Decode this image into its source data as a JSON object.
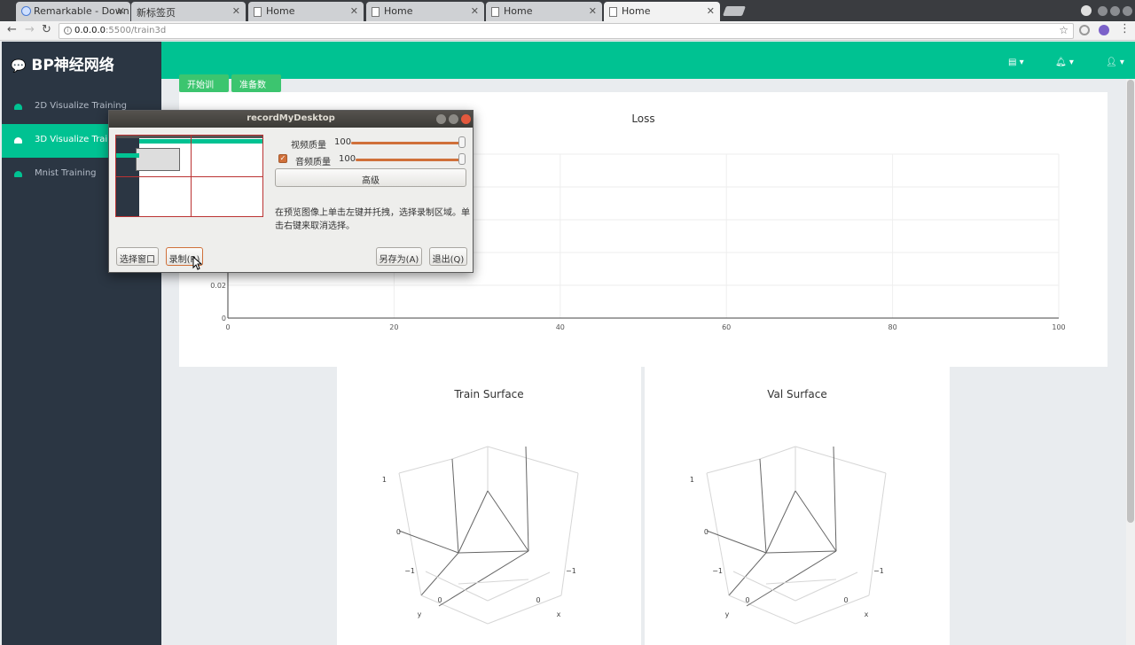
{
  "browser": {
    "tabs": [
      {
        "label": "Remarkable - Down",
        "active": false
      },
      {
        "label": "新标签页",
        "active": false
      },
      {
        "label": "Home",
        "active": false
      },
      {
        "label": "Home",
        "active": false
      },
      {
        "label": "Home",
        "active": false
      },
      {
        "label": "Home",
        "active": true
      }
    ],
    "address": {
      "host": "0.0.0.0",
      "path": ":5500/train3d"
    }
  },
  "app": {
    "brand": "BP神经网络",
    "nav": [
      {
        "label": "2D Visualize Training",
        "active": false
      },
      {
        "label": "3D Visualize Training",
        "active": true
      },
      {
        "label": "Mnist Training",
        "active": false
      }
    ],
    "buttons": {
      "start": "开始训练",
      "prepare": "准备数据"
    },
    "colors": {
      "accent": "#00c292",
      "sidebar": "#2b3643",
      "button": "#3cc56f"
    }
  },
  "chart_data": [
    {
      "type": "line",
      "title": "Loss",
      "x_ticks": [
        "0",
        "20",
        "40",
        "60",
        "80",
        "100"
      ],
      "y_ticks_visible": [
        "0",
        "0.02"
      ],
      "xlim": [
        0,
        100
      ],
      "grid": true,
      "series": []
    },
    {
      "type": "surface",
      "title": "Train Surface",
      "z_ticks": [
        "1",
        "0",
        "−1"
      ],
      "axes": {
        "x": "x",
        "y": "y"
      },
      "y_ticks": [
        "0",
        "−1"
      ]
    },
    {
      "type": "surface",
      "title": "Val Surface",
      "z_ticks": [
        "1",
        "0",
        "−1"
      ],
      "axes": {
        "x": "x",
        "y": "y"
      },
      "y_ticks": [
        "0",
        "−1"
      ]
    }
  ],
  "dialog": {
    "title": "recordMyDesktop",
    "video_label": "视频质量",
    "video_value": "100",
    "audio_label": "音频质量",
    "audio_value": "100",
    "audio_checked": true,
    "advanced": "高级",
    "hint": "在预览图像上单击左键并托拽，选择录制区域。单击右键来取消选择。",
    "select_window": "选择窗口",
    "record": "录制(R)",
    "save_as": "另存为(A)",
    "quit": "退出(Q)"
  }
}
